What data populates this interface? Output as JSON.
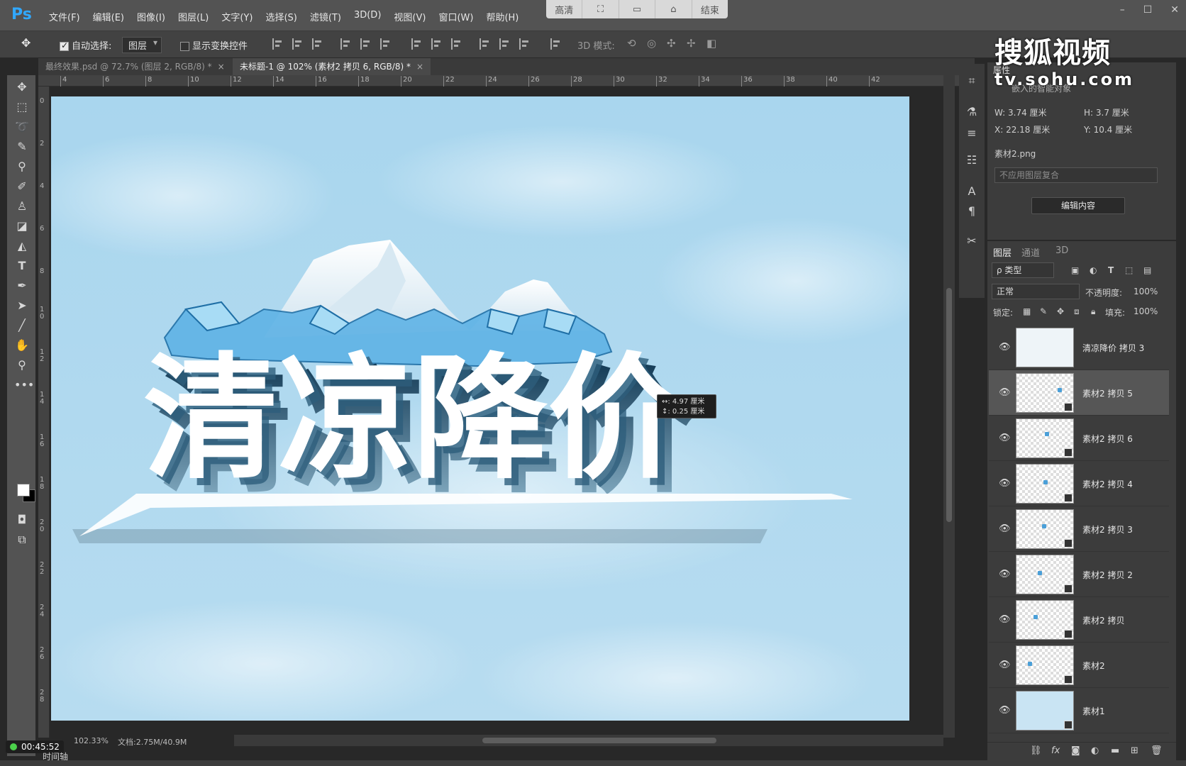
{
  "app": {
    "logo": "Ps",
    "menu": [
      "文件(F)",
      "编辑(E)",
      "图像(I)",
      "图层(L)",
      "文字(Y)",
      "选择(S)",
      "滤镜(T)",
      "3D(D)",
      "视图(V)",
      "窗口(W)",
      "帮助(H)"
    ],
    "view_pill": {
      "hd_label": "高清",
      "end_label": "结束"
    },
    "window_controls": [
      "–",
      "☐",
      "✕"
    ]
  },
  "options_bar": {
    "auto_select_label": "自动选择:",
    "auto_select_checked": true,
    "auto_select_target": "图层",
    "show_transform_label": "显示变换控件",
    "show_transform_checked": false,
    "mode_3d_label": "3D 模式:"
  },
  "tabs": [
    {
      "label": "最终效果.psd @ 72.7% (图层 2, RGB/8) *",
      "active": false
    },
    {
      "label": "未标题-1 @ 102% (素材2 拷贝 6, RGB/8) *",
      "active": true
    }
  ],
  "tab_close_glyph": "×",
  "ruler": {
    "top_ticks": [
      "4",
      "6",
      "8",
      "10",
      "12",
      "14",
      "16",
      "18",
      "20",
      "22",
      "24",
      "26",
      "28",
      "30",
      "32",
      "34",
      "36",
      "38",
      "40",
      "42"
    ],
    "left_ticks": [
      "0",
      "2",
      "4",
      "6",
      "8",
      "10",
      "12",
      "14",
      "16",
      "18",
      "20",
      "22",
      "24",
      "26",
      "28"
    ]
  },
  "canvas": {
    "headline": "清凉降价",
    "measure_tooltip": {
      "line1": "↔: 4.97 厘米",
      "line2": "↕: 0.25 厘米"
    }
  },
  "status": {
    "zoom": "102.33%",
    "doc_info": "文档:2.75M/40.9M",
    "timer": "00:45:52",
    "timeline_label": "时间轴"
  },
  "properties": {
    "title": "属性",
    "subtitle": "嵌入的智能对象",
    "w": "W:  3.74 厘米",
    "h": "H:  3.7 厘米",
    "x": "X:  22.18 厘米",
    "y": "Y:  10.4 厘米",
    "file": "素材2.png",
    "comp_placeholder": "不应用图层复合",
    "edit_button": "编辑内容"
  },
  "watermark": {
    "title": "搜狐视频",
    "url": "tv.sohu.com"
  },
  "layers_panel": {
    "tabs": [
      "图层",
      "通道",
      "3D"
    ],
    "filter_label": "ρ 类型",
    "blend_mode": "正常",
    "opacity_label": "不透明度:",
    "opacity_value": "100%",
    "lock_label": "锁定:",
    "fill_label": "填充:",
    "fill_value": "100%",
    "layers": [
      {
        "name": "清凉降价 拷贝 3",
        "selected": false
      },
      {
        "name": "素材2 拷贝 5",
        "selected": true
      },
      {
        "name": "素材2 拷贝 6",
        "selected": false
      },
      {
        "name": "素材2 拷贝 4",
        "selected": false
      },
      {
        "name": "素材2 拷贝 3",
        "selected": false
      },
      {
        "name": "素材2 拷贝 2",
        "selected": false
      },
      {
        "name": "素材2 拷贝",
        "selected": false
      },
      {
        "name": "素材2",
        "selected": false
      },
      {
        "name": "素材1",
        "selected": false
      }
    ]
  }
}
